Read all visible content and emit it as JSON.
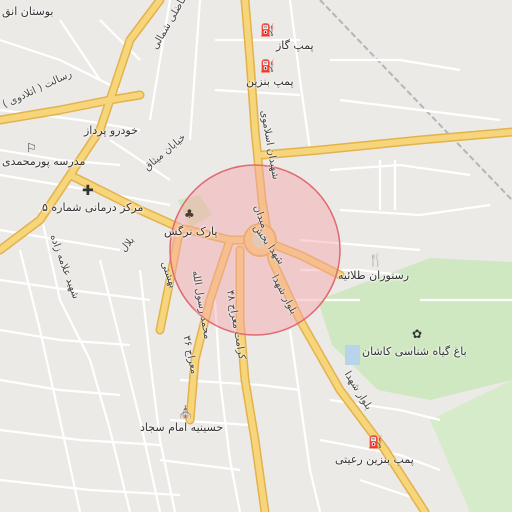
{
  "map": {
    "place_labels": {
      "bostan": "بوستان انق",
      "pomp_gaz": "پمپ گاز",
      "pomp_benzin": "پمپ بنزین",
      "madrese": "مدرسه پورمحمدی",
      "khodro": "خودرو پرداز",
      "markaz": "مرکز درمانی شماره ۵",
      "park": "پارک نرگس",
      "restoran": "رستوران طلائیه",
      "bagh": "باغ گیاه شناسی کاشان",
      "hosseinieh": "حسینیه امام سجاد",
      "pomp_rayeti": "پمپ بنزین رعیتی"
    },
    "road_labels": {
      "shomali": "فاضلی شمالی",
      "resalat": "رسالت ( اتلادوی )",
      "mikhak": "خیابان میثاق",
      "arvandi": "شهیدان اسلاموی",
      "allameh": "شهید علامه زاده",
      "bolvar1": "بلوار شهدا",
      "bolvar2": "بلوار شهدا",
      "meydan": "میدان",
      "mahdavi": "شهدا بخش",
      "mohammad": "محمد رسول الله",
      "kerman": "کرامت معراج ۴۸",
      "maraj": "معراج ۳۶",
      "beheshti": "بهشتی",
      "bel": "بلال"
    },
    "icons": {
      "gas": "fuel-pump-icon",
      "fuel": "fuel-pump-icon",
      "school": "school-icon",
      "clinic": "medical-cross-icon",
      "park": "tree-icon",
      "restaurant": "restaurant-icon",
      "garden": "flower-icon",
      "mosque": "mosque-icon",
      "fuel2": "fuel-pump-icon"
    },
    "colors": {
      "background": "#eceae6",
      "major_road": "#f7d57a",
      "major_road_casing": "#e3b24d",
      "minor_road": "#ffffff",
      "park_green": "#cfe8c1",
      "highlight_circle_fill": "#f6a3a8",
      "highlight_circle_stroke": "#e06a73",
      "railway": "#9a9a9a"
    }
  }
}
